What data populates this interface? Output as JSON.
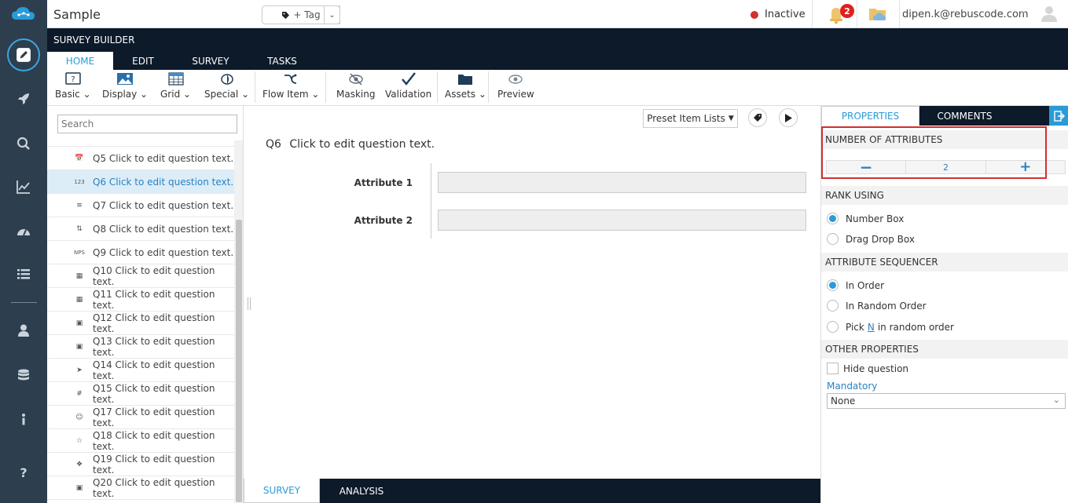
{
  "app": {
    "title": "Sample"
  },
  "topbar": {
    "tag_label": "+ Tag",
    "status": "Inactive",
    "status_color": "#d32f2f",
    "notification_count": "2",
    "user_email": "dipen.k@rebuscode.com"
  },
  "builder": {
    "title": "SURVEY BUILDER",
    "tabs": [
      "HOME",
      "EDIT",
      "SURVEY",
      "TASKS"
    ]
  },
  "ribbon": {
    "basic": "Basic",
    "display": "Display",
    "grid": "Grid",
    "special": "Special",
    "flow_item": "Flow Item",
    "masking": "Masking",
    "validation": "Validation",
    "assets": "Assets",
    "preview": "Preview"
  },
  "question_list": {
    "search_placeholder": "Search",
    "items": [
      {
        "label": "Q5 Click to edit question text.",
        "icon": "calendar-icon"
      },
      {
        "label": "Q6 Click to edit question text.",
        "icon": "rank-123-icon"
      },
      {
        "label": "Q7 Click to edit question text.",
        "icon": "sort-list-icon"
      },
      {
        "label": "Q8 Click to edit question text.",
        "icon": "sliders-icon"
      },
      {
        "label": "Q9 Click to edit question text.",
        "icon": "nps-icon"
      },
      {
        "label": "Q10 Click to edit question text.",
        "icon": "grid-icon"
      },
      {
        "label": "Q11 Click to edit question text.",
        "icon": "grid-icon"
      },
      {
        "label": "Q12 Click to edit question text.",
        "icon": "text-grid-icon"
      },
      {
        "label": "Q13 Click to edit question text.",
        "icon": "text-grid-icon"
      },
      {
        "label": "Q14 Click to edit question text.",
        "icon": "paper-plane-icon"
      },
      {
        "label": "Q15 Click to edit question text.",
        "icon": "hash-icon"
      },
      {
        "label": "Q17 Click to edit question text.",
        "icon": "smiley-icon"
      },
      {
        "label": "Q18 Click to edit question text.",
        "icon": "star-icon"
      },
      {
        "label": "Q19 Click to edit question text.",
        "icon": "puzzle-icon"
      },
      {
        "label": "Q20 Click to edit question text.",
        "icon": "text-grid-icon"
      }
    ]
  },
  "canvas": {
    "preset_label": "Preset Item Lists",
    "question_number": "Q6",
    "question_text": "Click to edit question text.",
    "attributes": [
      "Attribute 1",
      "Attribute 2"
    ]
  },
  "bottom_tabs": [
    "SURVEY",
    "ANALYSIS"
  ],
  "properties": {
    "tabs": [
      "PROPERTIES",
      "COMMENTS"
    ],
    "number_of_attributes": {
      "title": "NUMBER OF ATTRIBUTES",
      "value": "2"
    },
    "rank_using": {
      "title": "RANK USING",
      "options": [
        "Number Box",
        "Drag Drop Box"
      ],
      "selected": 0
    },
    "attribute_sequencer": {
      "title": "ATTRIBUTE SEQUENCER",
      "options": [
        "In Order",
        "In Random Order"
      ],
      "pick_prefix": "Pick",
      "pick_link": "N",
      "pick_suffix": "in random order",
      "selected": 0
    },
    "other": {
      "title": "OTHER PROPERTIES",
      "hide_question": "Hide question",
      "mandatory_label": "Mandatory",
      "mandatory_value": "None"
    }
  },
  "colors": {
    "accent": "#2a9bd8",
    "dark": "#0c1a2a",
    "rail": "#2d3e4e",
    "highlight": "#d03030"
  }
}
